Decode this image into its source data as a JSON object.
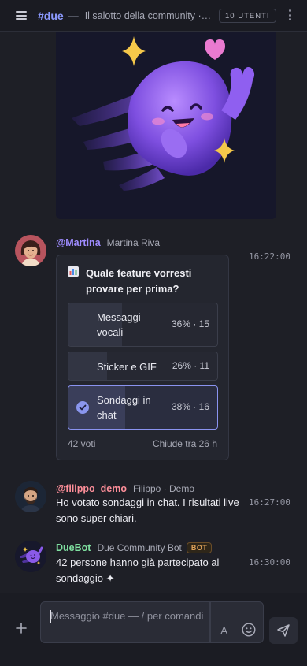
{
  "header": {
    "channel": "#due",
    "separator": "—",
    "topic": "Il salotto della community ·…",
    "users_badge": "10 UTENTI"
  },
  "messages": [
    {
      "handle": "@Martina",
      "real_name": "Martina Riva",
      "time": "16:22:00",
      "poll": {
        "question": "Quale feature vorresti provare per prima?",
        "options": [
          {
            "label": "Messaggi vocali",
            "stats": "36% · 15",
            "percent": 36,
            "selected": false
          },
          {
            "label": "Sticker e GIF",
            "stats": "26% · 11",
            "percent": 26,
            "selected": false
          },
          {
            "label": "Sondaggi in chat",
            "stats": "38% · 16",
            "percent": 38,
            "selected": true
          }
        ],
        "votes": "42 voti",
        "closes": "Chiude tra 26 h"
      }
    },
    {
      "handle": "@filippo_demo",
      "real_name": "Filippo · Demo",
      "time": "16:27:00",
      "text": "Ho votato sondaggi in chat. I risultati live sono super chiari."
    },
    {
      "handle": "DueBot",
      "real_name": "Due Community Bot",
      "badge": "BOT",
      "time": "16:30:00",
      "text": "42 persone hanno già partecipato al sondaggio ✦"
    }
  ],
  "composer": {
    "placeholder": "Messaggio #due — / per comandi",
    "format_label": "A"
  },
  "colors": {
    "accent": "#8c9aff",
    "martina_handle": "#9f8cff",
    "filippo_handle": "#ff8f9a",
    "bot_name": "#7fe0a0",
    "bot_badge": "#e0a35a"
  }
}
